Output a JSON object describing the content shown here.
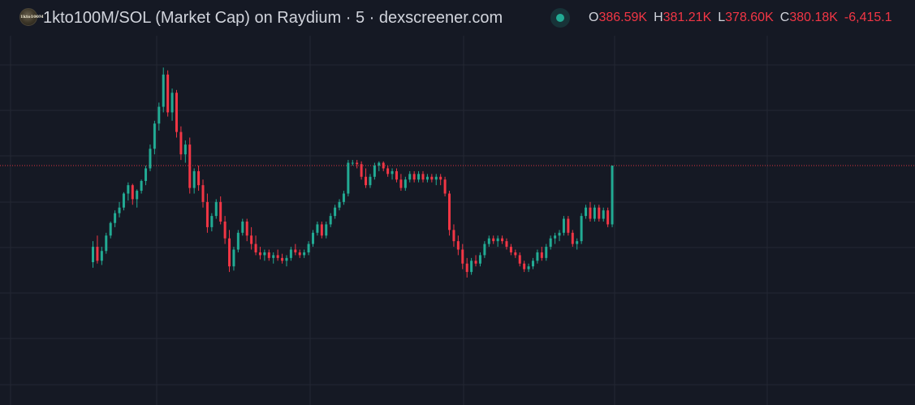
{
  "header": {
    "logo_text": "1kto100M",
    "title": "1kto100M/SOL (Market Cap) on Raydium · 5 · dexscreener.com",
    "ohlc": [
      {
        "key": "O",
        "value": "386.59K"
      },
      {
        "key": "H",
        "value": "381.21K"
      },
      {
        "key": "L",
        "value": "378.60K"
      },
      {
        "key": "C",
        "value": "380.18K"
      }
    ],
    "change": "-6,415.1",
    "ohlc_color": "#f23645"
  },
  "colors": {
    "background": "#151924",
    "grid": "#232733",
    "up": "#22ab94",
    "down": "#f23645",
    "price_line": "#f23645"
  },
  "chart_data": {
    "type": "candlestick",
    "title": "1kto100M/SOL (Market Cap) on Raydium · 5 · dexscreener.com",
    "interval": "5",
    "grid": true,
    "ylim": [
      0,
      100
    ],
    "last_price_line": 80,
    "candles": [
      {
        "o": 11,
        "h": 26,
        "l": 7,
        "c": 22
      },
      {
        "o": 22,
        "h": 30,
        "l": 10,
        "c": 12
      },
      {
        "o": 12,
        "h": 22,
        "l": 9,
        "c": 19
      },
      {
        "o": 19,
        "h": 32,
        "l": 17,
        "c": 30
      },
      {
        "o": 30,
        "h": 40,
        "l": 28,
        "c": 39
      },
      {
        "o": 39,
        "h": 48,
        "l": 36,
        "c": 46
      },
      {
        "o": 46,
        "h": 54,
        "l": 43,
        "c": 50
      },
      {
        "o": 50,
        "h": 61,
        "l": 48,
        "c": 60
      },
      {
        "o": 60,
        "h": 68,
        "l": 55,
        "c": 66
      },
      {
        "o": 66,
        "h": 67,
        "l": 52,
        "c": 56
      },
      {
        "o": 56,
        "h": 63,
        "l": 50,
        "c": 62
      },
      {
        "o": 62,
        "h": 70,
        "l": 60,
        "c": 69
      },
      {
        "o": 69,
        "h": 80,
        "l": 66,
        "c": 78
      },
      {
        "o": 78,
        "h": 95,
        "l": 76,
        "c": 92
      },
      {
        "o": 92,
        "h": 112,
        "l": 88,
        "c": 110
      },
      {
        "o": 110,
        "h": 125,
        "l": 105,
        "c": 122
      },
      {
        "o": 122,
        "h": 150,
        "l": 118,
        "c": 145
      },
      {
        "o": 145,
        "h": 148,
        "l": 115,
        "c": 118
      },
      {
        "o": 118,
        "h": 135,
        "l": 112,
        "c": 132
      },
      {
        "o": 132,
        "h": 134,
        "l": 100,
        "c": 104
      },
      {
        "o": 104,
        "h": 108,
        "l": 84,
        "c": 88
      },
      {
        "o": 88,
        "h": 98,
        "l": 82,
        "c": 95
      },
      {
        "o": 95,
        "h": 100,
        "l": 60,
        "c": 64
      },
      {
        "o": 64,
        "h": 78,
        "l": 60,
        "c": 76
      },
      {
        "o": 76,
        "h": 80,
        "l": 62,
        "c": 66
      },
      {
        "o": 66,
        "h": 70,
        "l": 50,
        "c": 54
      },
      {
        "o": 54,
        "h": 60,
        "l": 32,
        "c": 36
      },
      {
        "o": 36,
        "h": 46,
        "l": 33,
        "c": 44
      },
      {
        "o": 44,
        "h": 56,
        "l": 42,
        "c": 54
      },
      {
        "o": 54,
        "h": 58,
        "l": 38,
        "c": 40
      },
      {
        "o": 40,
        "h": 44,
        "l": 24,
        "c": 28
      },
      {
        "o": 28,
        "h": 34,
        "l": 4,
        "c": 8
      },
      {
        "o": 8,
        "h": 22,
        "l": 5,
        "c": 20
      },
      {
        "o": 20,
        "h": 34,
        "l": 18,
        "c": 32
      },
      {
        "o": 32,
        "h": 42,
        "l": 30,
        "c": 40
      },
      {
        "o": 40,
        "h": 42,
        "l": 26,
        "c": 30
      },
      {
        "o": 30,
        "h": 36,
        "l": 20,
        "c": 24
      },
      {
        "o": 24,
        "h": 30,
        "l": 16,
        "c": 18
      },
      {
        "o": 18,
        "h": 22,
        "l": 13,
        "c": 16
      },
      {
        "o": 16,
        "h": 20,
        "l": 12,
        "c": 18
      },
      {
        "o": 18,
        "h": 20,
        "l": 12,
        "c": 14
      },
      {
        "o": 14,
        "h": 18,
        "l": 10,
        "c": 16
      },
      {
        "o": 16,
        "h": 20,
        "l": 12,
        "c": 14
      },
      {
        "o": 14,
        "h": 17,
        "l": 10,
        "c": 12
      },
      {
        "o": 12,
        "h": 16,
        "l": 8,
        "c": 14
      },
      {
        "o": 14,
        "h": 22,
        "l": 12,
        "c": 20
      },
      {
        "o": 20,
        "h": 24,
        "l": 16,
        "c": 18
      },
      {
        "o": 18,
        "h": 20,
        "l": 14,
        "c": 16
      },
      {
        "o": 16,
        "h": 20,
        "l": 14,
        "c": 18
      },
      {
        "o": 18,
        "h": 26,
        "l": 16,
        "c": 24
      },
      {
        "o": 24,
        "h": 34,
        "l": 22,
        "c": 32
      },
      {
        "o": 32,
        "h": 40,
        "l": 30,
        "c": 38
      },
      {
        "o": 38,
        "h": 40,
        "l": 28,
        "c": 30
      },
      {
        "o": 30,
        "h": 40,
        "l": 28,
        "c": 38
      },
      {
        "o": 38,
        "h": 46,
        "l": 36,
        "c": 44
      },
      {
        "o": 44,
        "h": 52,
        "l": 42,
        "c": 50
      },
      {
        "o": 50,
        "h": 56,
        "l": 48,
        "c": 54
      },
      {
        "o": 54,
        "h": 62,
        "l": 52,
        "c": 60
      },
      {
        "o": 60,
        "h": 84,
        "l": 58,
        "c": 82
      },
      {
        "o": 82,
        "h": 84,
        "l": 80,
        "c": 82
      },
      {
        "o": 82,
        "h": 84,
        "l": 78,
        "c": 81
      },
      {
        "o": 81,
        "h": 83,
        "l": 70,
        "c": 72
      },
      {
        "o": 72,
        "h": 78,
        "l": 64,
        "c": 66
      },
      {
        "o": 66,
        "h": 74,
        "l": 64,
        "c": 72
      },
      {
        "o": 72,
        "h": 82,
        "l": 70,
        "c": 80
      },
      {
        "o": 80,
        "h": 83,
        "l": 76,
        "c": 82
      },
      {
        "o": 82,
        "h": 83,
        "l": 76,
        "c": 78
      },
      {
        "o": 78,
        "h": 80,
        "l": 72,
        "c": 74
      },
      {
        "o": 74,
        "h": 78,
        "l": 70,
        "c": 76
      },
      {
        "o": 76,
        "h": 78,
        "l": 68,
        "c": 70
      },
      {
        "o": 70,
        "h": 74,
        "l": 62,
        "c": 64
      },
      {
        "o": 64,
        "h": 72,
        "l": 62,
        "c": 70
      },
      {
        "o": 70,
        "h": 76,
        "l": 68,
        "c": 74
      },
      {
        "o": 74,
        "h": 76,
        "l": 68,
        "c": 70
      },
      {
        "o": 70,
        "h": 76,
        "l": 68,
        "c": 74
      },
      {
        "o": 74,
        "h": 76,
        "l": 68,
        "c": 70
      },
      {
        "o": 70,
        "h": 74,
        "l": 68,
        "c": 72
      },
      {
        "o": 72,
        "h": 74,
        "l": 68,
        "c": 70
      },
      {
        "o": 70,
        "h": 74,
        "l": 66,
        "c": 72
      },
      {
        "o": 72,
        "h": 74,
        "l": 66,
        "c": 70
      },
      {
        "o": 70,
        "h": 72,
        "l": 58,
        "c": 60
      },
      {
        "o": 60,
        "h": 62,
        "l": 30,
        "c": 34
      },
      {
        "o": 34,
        "h": 38,
        "l": 22,
        "c": 26
      },
      {
        "o": 26,
        "h": 30,
        "l": 16,
        "c": 20
      },
      {
        "o": 20,
        "h": 24,
        "l": 6,
        "c": 10
      },
      {
        "o": 10,
        "h": 14,
        "l": 0,
        "c": 4
      },
      {
        "o": 4,
        "h": 14,
        "l": 2,
        "c": 12
      },
      {
        "o": 12,
        "h": 16,
        "l": 8,
        "c": 10
      },
      {
        "o": 10,
        "h": 18,
        "l": 8,
        "c": 16
      },
      {
        "o": 16,
        "h": 26,
        "l": 14,
        "c": 24
      },
      {
        "o": 24,
        "h": 30,
        "l": 22,
        "c": 28
      },
      {
        "o": 28,
        "h": 30,
        "l": 24,
        "c": 26
      },
      {
        "o": 26,
        "h": 30,
        "l": 22,
        "c": 28
      },
      {
        "o": 28,
        "h": 30,
        "l": 24,
        "c": 26
      },
      {
        "o": 26,
        "h": 28,
        "l": 20,
        "c": 22
      },
      {
        "o": 22,
        "h": 24,
        "l": 16,
        "c": 18
      },
      {
        "o": 18,
        "h": 20,
        "l": 14,
        "c": 16
      },
      {
        "o": 16,
        "h": 18,
        "l": 8,
        "c": 10
      },
      {
        "o": 10,
        "h": 12,
        "l": 4,
        "c": 6
      },
      {
        "o": 6,
        "h": 10,
        "l": 4,
        "c": 8
      },
      {
        "o": 8,
        "h": 14,
        "l": 6,
        "c": 12
      },
      {
        "o": 12,
        "h": 20,
        "l": 10,
        "c": 18
      },
      {
        "o": 18,
        "h": 22,
        "l": 12,
        "c": 14
      },
      {
        "o": 14,
        "h": 24,
        "l": 12,
        "c": 22
      },
      {
        "o": 22,
        "h": 30,
        "l": 20,
        "c": 28
      },
      {
        "o": 28,
        "h": 32,
        "l": 24,
        "c": 30
      },
      {
        "o": 30,
        "h": 34,
        "l": 26,
        "c": 32
      },
      {
        "o": 32,
        "h": 44,
        "l": 30,
        "c": 42
      },
      {
        "o": 42,
        "h": 44,
        "l": 30,
        "c": 32
      },
      {
        "o": 32,
        "h": 34,
        "l": 22,
        "c": 24
      },
      {
        "o": 24,
        "h": 28,
        "l": 20,
        "c": 26
      },
      {
        "o": 26,
        "h": 46,
        "l": 24,
        "c": 44
      },
      {
        "o": 44,
        "h": 52,
        "l": 42,
        "c": 50
      },
      {
        "o": 50,
        "h": 54,
        "l": 40,
        "c": 42
      },
      {
        "o": 42,
        "h": 52,
        "l": 40,
        "c": 50
      },
      {
        "o": 50,
        "h": 52,
        "l": 40,
        "c": 42
      },
      {
        "o": 42,
        "h": 50,
        "l": 40,
        "c": 48
      },
      {
        "o": 48,
        "h": 50,
        "l": 36,
        "c": 38
      },
      {
        "o": 38,
        "h": 80,
        "l": 36,
        "c": 80
      }
    ]
  }
}
